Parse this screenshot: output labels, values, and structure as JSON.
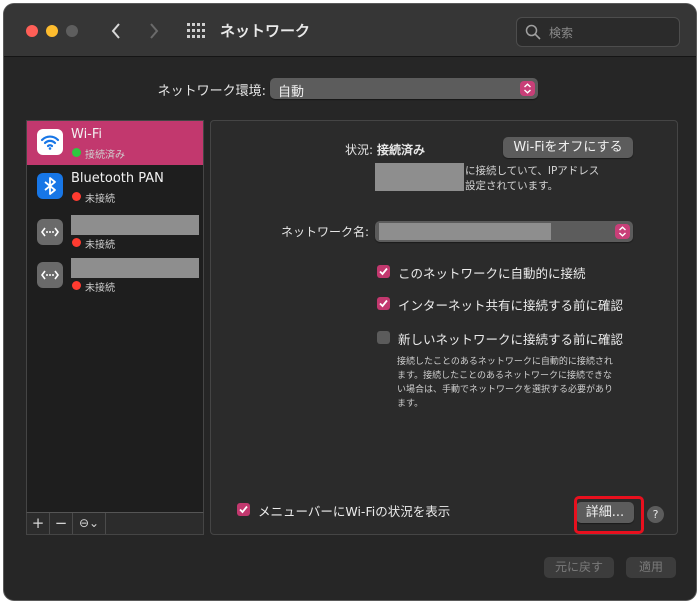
{
  "window": {
    "title": "ネットワーク",
    "search_placeholder": "検索"
  },
  "location": {
    "label": "ネットワーク環境:",
    "value": "自動"
  },
  "services": [
    {
      "name": "Wi-Fi",
      "status": "接続済み",
      "status_color": "#2fc840",
      "icon": "wifi-icon",
      "selected": true
    },
    {
      "name": "Bluetooth PAN",
      "status": "未接続",
      "status_color": "#ff3b30",
      "icon": "bluetooth-icon",
      "selected": false
    },
    {
      "name": "",
      "status": "未接続",
      "status_color": "#ff3b30",
      "icon": "ethernet-dots-icon",
      "selected": false
    },
    {
      "name": "",
      "status": "未接続",
      "status_color": "#ff3b30",
      "icon": "ethernet-dots-icon",
      "selected": false
    }
  ],
  "sidebar_controls": {
    "add": "+",
    "remove": "−",
    "action": "⊖⌄"
  },
  "detail": {
    "status_label": "状況:",
    "status_value": "接続済み",
    "wifi_off_button": "Wi-Fiをオフにする",
    "status_desc_line1": "に接続していて、IPアドレス",
    "status_desc_line2": "設定されています。",
    "network_name_label": "ネットワーク名:",
    "checkbox_auto_join": "このネットワークに自動的に接続",
    "checkbox_hotspot_confirm": "インターネット共有に接続する前に確認",
    "checkbox_new_network_confirm": "新しいネットワークに接続する前に確認",
    "note_lines": [
      "接続したことのあるネットワークに自動的に接続され",
      "ます。接続したことのあるネットワークに接続できな",
      "い場合は、手動でネットワークを選択する必要があり",
      "ます。"
    ],
    "show_in_menubar": "メニューバーにWi-Fiの状況を表示",
    "advanced_button": "詳細...",
    "help_button": "?"
  },
  "footer": {
    "revert_button": "元に戻す",
    "apply_button": "適用"
  },
  "colors": {
    "accent": "#c2386e",
    "highlight": "#e8101e"
  }
}
